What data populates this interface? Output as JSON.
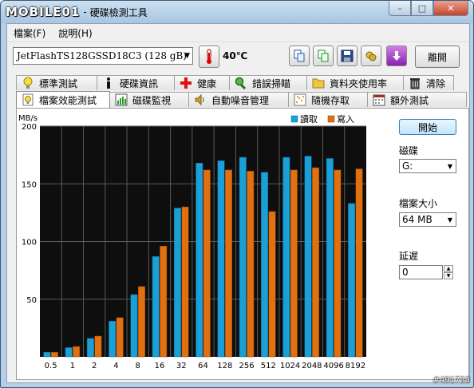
{
  "window": {
    "brand": "MOBILE01",
    "separator": "-",
    "title": "硬碟檢測工具",
    "buttons": {
      "minimize": "–",
      "maximize": "□",
      "close": "✕"
    }
  },
  "menu": {
    "file": "檔案(F)",
    "help": "說明(H)"
  },
  "toolbar": {
    "drive": "JetFlashTS128GSSD18C3 (128 gB)",
    "temperature": "40℃",
    "exit_label": "離開",
    "icons": [
      "copy-icon",
      "copy-report-icon",
      "save-icon",
      "screenshot-icon",
      "download-icon"
    ]
  },
  "tabs_row1": [
    {
      "label": "標準測試",
      "icon": "lightbulb-icon"
    },
    {
      "label": "硬碟資訊",
      "icon": "info-icon"
    },
    {
      "label": "健康",
      "icon": "health-cross-icon"
    },
    {
      "label": "錯誤掃瞄",
      "icon": "magnifier-icon"
    },
    {
      "label": "資料夾使用率",
      "icon": "folder-icon"
    },
    {
      "label": "清除",
      "icon": "trash-icon"
    }
  ],
  "tabs_row2": [
    {
      "label": "檔案效能測試",
      "icon": "file-bulb-icon",
      "active": true
    },
    {
      "label": "磁碟監視",
      "icon": "monitor-chart-icon"
    },
    {
      "label": "自動噪音管理",
      "icon": "speaker-icon"
    },
    {
      "label": "隨機存取",
      "icon": "scatter-icon"
    },
    {
      "label": "額外測試",
      "icon": "calendar-icon"
    }
  ],
  "side": {
    "start_label": "開始",
    "disk_label": "磁碟",
    "disk_value": "G:",
    "filesize_label": "檔案大小",
    "filesize_value": "64 MB",
    "delay_label": "延遲",
    "delay_value": "0"
  },
  "watermark": "#491733",
  "colors": {
    "read": "#1a9fd6",
    "write": "#e07010",
    "plot_bg": "#0e0e0e",
    "grid": "#5a5a5a"
  },
  "chart_data": {
    "type": "bar",
    "ylabel": "MB/s",
    "ylim": [
      0,
      200
    ],
    "yticks": [
      50,
      100,
      150,
      200
    ],
    "categories": [
      "0.5",
      "1",
      "2",
      "4",
      "8",
      "16",
      "32",
      "64",
      "128",
      "256",
      "512",
      "1024",
      "2048",
      "4096",
      "8192"
    ],
    "series": [
      {
        "name": "讀取",
        "values": [
          4,
          8,
          16,
          31,
          54,
          87,
          129,
          168,
          170,
          173,
          160,
          173,
          174,
          172,
          133
        ]
      },
      {
        "name": "寫入",
        "values": [
          4,
          9,
          18,
          34,
          61,
          96,
          130,
          162,
          162,
          161,
          126,
          162,
          164,
          162,
          163
        ]
      }
    ],
    "legend_position": "top-right",
    "grid": true
  }
}
